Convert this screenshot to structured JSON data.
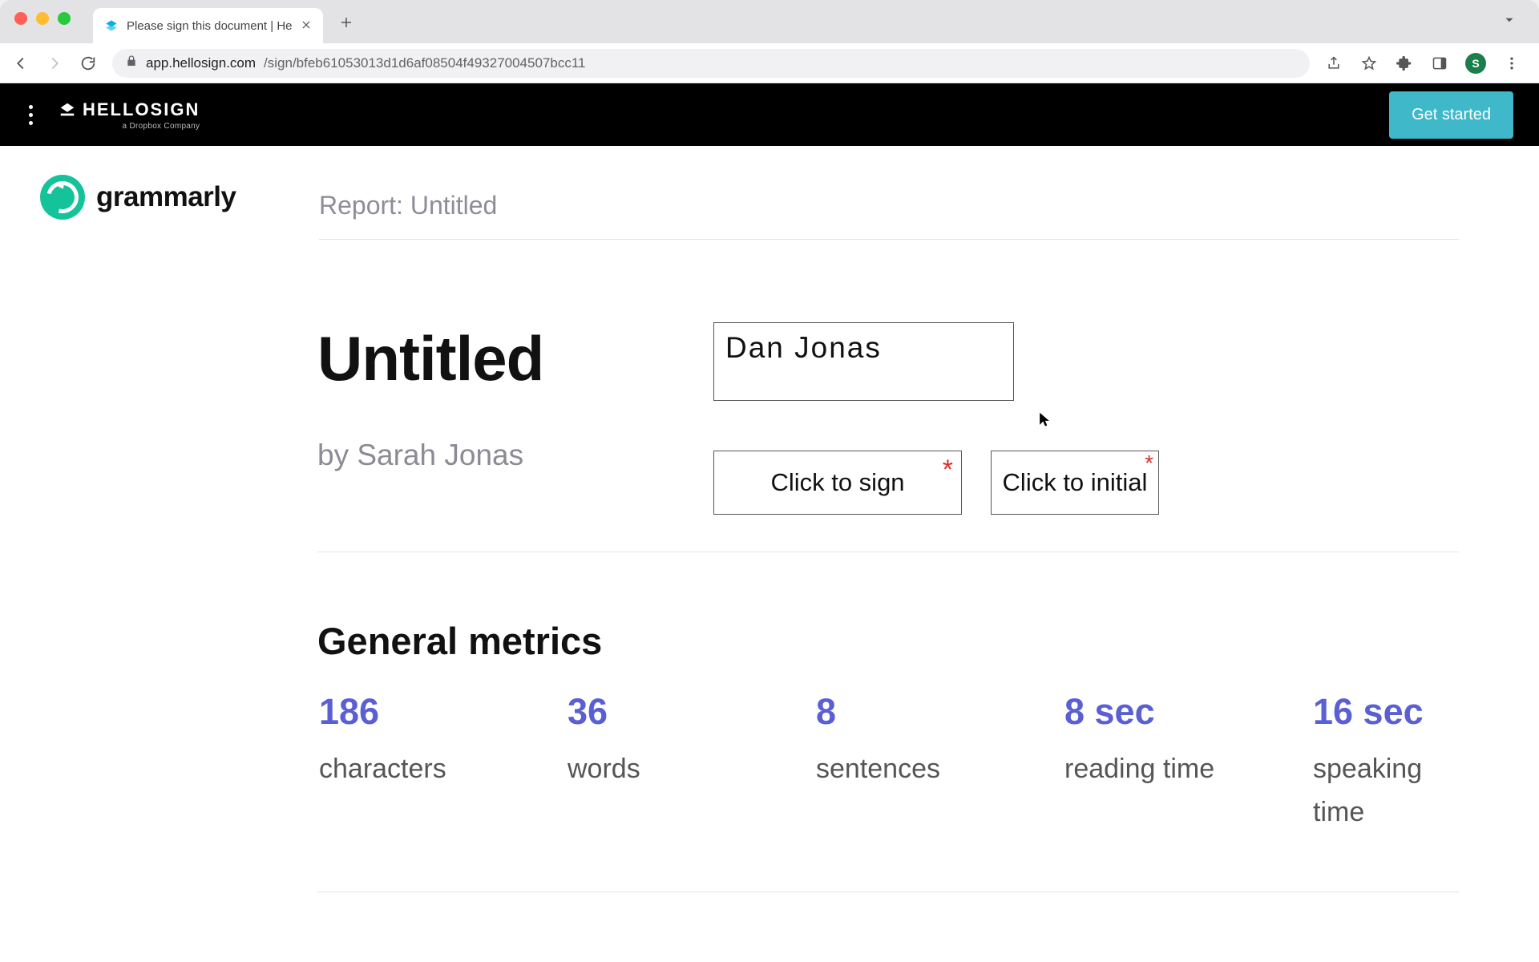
{
  "browser": {
    "tab_title": "Please sign this document | He",
    "url_origin": "app.hellosign.com",
    "url_path": "/sign/bfeb61053013d1d6af08504f49327004507bcc11",
    "avatar_initial": "S"
  },
  "header": {
    "brand_name": "HELLOSIGN",
    "brand_sub": "a Dropbox Company",
    "cta": "Get started"
  },
  "doc": {
    "grammarly_word": "grammarly",
    "report_prefix": "Report: ",
    "report_title": "Untitled",
    "title": "Untitled",
    "byline": "by Sarah Jonas",
    "name_field_value": "Dan Jonas",
    "sign_label": "Click to sign",
    "initial_label": "Click to initial",
    "metrics_heading": "General metrics",
    "metrics": [
      {
        "value": "186",
        "label": "characters"
      },
      {
        "value": "36",
        "label": "words"
      },
      {
        "value": "8",
        "label": "sentences"
      },
      {
        "value": "8 sec",
        "label": "reading time"
      },
      {
        "value": "16 sec",
        "label": "speaking time"
      }
    ]
  }
}
